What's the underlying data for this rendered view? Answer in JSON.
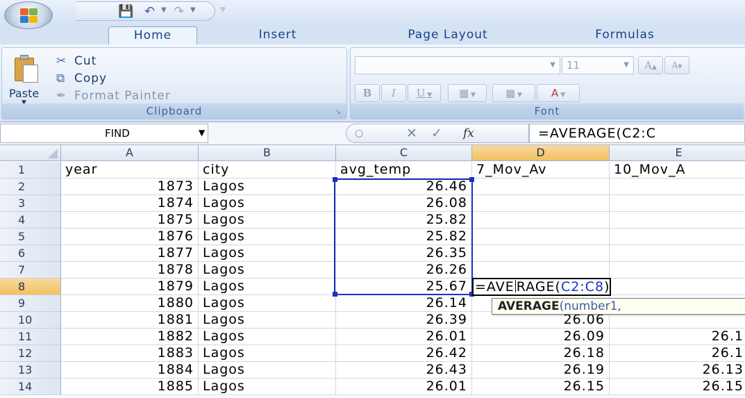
{
  "tabs": [
    "Home",
    "Insert",
    "Page Layout",
    "Formulas"
  ],
  "clipboard": {
    "paste_label": "Paste",
    "cut_label": "Cut",
    "copy_label": "Copy",
    "format_painter_label": "Format Painter",
    "group_label": "Clipboard"
  },
  "font": {
    "font_name": "",
    "font_size": "11",
    "bold": "B",
    "italic": "I",
    "underline": "U",
    "grow": "A",
    "shrink": "A",
    "font_color": "A",
    "group_label": "Font"
  },
  "formula_bar": {
    "name_box": "FIND",
    "fx": "fx",
    "formula": "=AVERAGE(C2:C"
  },
  "columns": [
    "A",
    "B",
    "C",
    "D",
    "E"
  ],
  "active_column": "D",
  "active_row": "8",
  "rows": [
    {
      "n": "1",
      "a": "year",
      "b": "city",
      "c": "avg_temp",
      "d": "7_Mov_Av",
      "e": "10_Mov_A"
    },
    {
      "n": "2",
      "a": "1873",
      "b": "Lagos",
      "c": "26.46",
      "d": "",
      "e": ""
    },
    {
      "n": "3",
      "a": "1874",
      "b": "Lagos",
      "c": "26.08",
      "d": "",
      "e": ""
    },
    {
      "n": "4",
      "a": "1875",
      "b": "Lagos",
      "c": "25.82",
      "d": "",
      "e": ""
    },
    {
      "n": "5",
      "a": "1876",
      "b": "Lagos",
      "c": "25.82",
      "d": "",
      "e": ""
    },
    {
      "n": "6",
      "a": "1877",
      "b": "Lagos",
      "c": "26.35",
      "d": "",
      "e": ""
    },
    {
      "n": "7",
      "a": "1878",
      "b": "Lagos",
      "c": "26.26",
      "d": "",
      "e": ""
    },
    {
      "n": "8",
      "a": "1879",
      "b": "Lagos",
      "c": "25.67",
      "d": "",
      "e": ""
    },
    {
      "n": "9",
      "a": "1880",
      "b": "Lagos",
      "c": "26.14",
      "d": "",
      "e": ""
    },
    {
      "n": "10",
      "a": "1881",
      "b": "Lagos",
      "c": "26.39",
      "d": "26.06",
      "e": ""
    },
    {
      "n": "11",
      "a": "1882",
      "b": "Lagos",
      "c": "26.01",
      "d": "26.09",
      "e": "26.1"
    },
    {
      "n": "12",
      "a": "1883",
      "b": "Lagos",
      "c": "26.42",
      "d": "26.18",
      "e": "26.1"
    },
    {
      "n": "13",
      "a": "1884",
      "b": "Lagos",
      "c": "26.43",
      "d": "26.19",
      "e": "26.13"
    },
    {
      "n": "14",
      "a": "1885",
      "b": "Lagos",
      "c": "26.01",
      "d": "26.15",
      "e": "26.15"
    }
  ],
  "editing": {
    "prefix": "=AVE",
    "rest": "RAGE(",
    "ref": "C2:C8",
    "suffix": ")"
  },
  "tooltip": {
    "fn": "AVERAGE",
    "args": "(number1,"
  },
  "colors": {
    "range_border": "#1c2fbf",
    "active_header": "#f1c15f",
    "ribbon_text": "#15428b"
  }
}
